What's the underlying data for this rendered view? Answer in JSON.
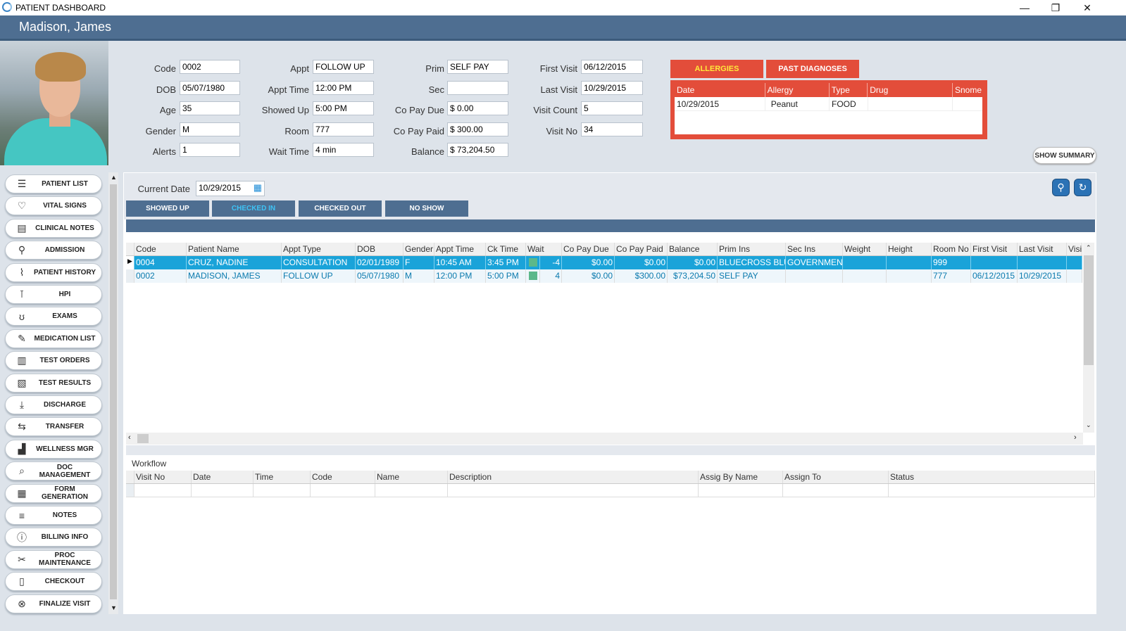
{
  "window": {
    "title": "PATIENT DASHBOARD"
  },
  "header": {
    "patient_name": "Madison, James"
  },
  "info": {
    "col1": [
      {
        "label": "Code",
        "value": "0002"
      },
      {
        "label": "DOB",
        "value": "05/07/1980"
      },
      {
        "label": "Age",
        "value": "35"
      },
      {
        "label": "Gender",
        "value": "M"
      },
      {
        "label": "Alerts",
        "value": "1"
      }
    ],
    "col2": [
      {
        "label": "Appt",
        "value": "FOLLOW UP"
      },
      {
        "label": "Appt Time",
        "value": "12:00 PM"
      },
      {
        "label": "Showed Up",
        "value": "5:00 PM"
      },
      {
        "label": "Room",
        "value": "777"
      },
      {
        "label": "Wait Time",
        "value": "4 min"
      }
    ],
    "col3": [
      {
        "label": "Prim",
        "value": "SELF PAY"
      },
      {
        "label": "Sec",
        "value": ""
      },
      {
        "label": "Co Pay Due",
        "value": "$ 0.00"
      },
      {
        "label": "Co Pay Paid",
        "value": "$ 300.00"
      },
      {
        "label": "Balance",
        "value": "$ 73,204.50"
      }
    ],
    "col4": [
      {
        "label": "First Visit",
        "value": "06/12/2015"
      },
      {
        "label": "Last Visit",
        "value": "10/29/2015"
      },
      {
        "label": "Visit Count",
        "value": "5"
      },
      {
        "label": "Visit No",
        "value": "34"
      }
    ]
  },
  "allergies": {
    "tab_allergies": "ALLERGIES",
    "tab_past": "PAST DIAGNOSES",
    "columns": [
      "Date",
      "Allergy",
      "Type",
      "Drug",
      "Snome"
    ],
    "rows": [
      [
        "10/29/2015",
        "Peanut",
        "FOOD",
        "",
        ""
      ]
    ]
  },
  "show_summary": "SHOW SUMMARY",
  "sidebar": {
    "items": [
      {
        "label": "PATIENT LIST",
        "icon": "id-card-icon",
        "glyph": "☰"
      },
      {
        "label": "VITAL SIGNS",
        "icon": "heartbeat-icon",
        "glyph": "♡"
      },
      {
        "label": "CLINICAL NOTES",
        "icon": "clinical-notes-icon",
        "glyph": "▤"
      },
      {
        "label": "ADMISSION",
        "icon": "admission-user-icon",
        "glyph": "⚲"
      },
      {
        "label": "PATIENT HISTORY",
        "icon": "chart-icon",
        "glyph": "⌇"
      },
      {
        "label": "HPI",
        "icon": "thermometer-icon",
        "glyph": "⊺"
      },
      {
        "label": "EXAMS",
        "icon": "stethoscope-icon",
        "glyph": "ʊ"
      },
      {
        "label": "MEDICATION LIST",
        "icon": "edit-list-icon",
        "glyph": "✎"
      },
      {
        "label": "TEST ORDERS",
        "icon": "clipboard-icon",
        "glyph": "▥"
      },
      {
        "label": "TEST RESULTS",
        "icon": "clipboard-check-icon",
        "glyph": "▧"
      },
      {
        "label": "DISCHARGE",
        "icon": "download-tray-icon",
        "glyph": "⤓"
      },
      {
        "label": "TRANSFER",
        "icon": "transfer-icon",
        "glyph": "⇆"
      },
      {
        "label": "WELLNESS MGR",
        "icon": "growth-chart-icon",
        "glyph": "▟"
      },
      {
        "label": "DOC MANAGEMENT",
        "icon": "document-search-icon",
        "glyph": "⌕"
      },
      {
        "label": "FORM GENERATION",
        "icon": "form-icon",
        "glyph": "▦"
      },
      {
        "label": "NOTES",
        "icon": "notes-icon",
        "glyph": "≡"
      },
      {
        "label": "BILLING INFO",
        "icon": "info-icon",
        "glyph": "ⓘ"
      },
      {
        "label": "PROC MAINTENANCE",
        "icon": "tools-icon",
        "glyph": "✂"
      },
      {
        "label": "CHECKOUT",
        "icon": "book-icon",
        "glyph": "▯"
      },
      {
        "label": "FINALIZE VISIT",
        "icon": "cancel-circle-icon",
        "glyph": "⊗"
      }
    ]
  },
  "main": {
    "current_date_label": "Current Date",
    "current_date_value": "10/29/2015",
    "tabs": [
      "SHOWED UP",
      "CHECKED IN",
      "CHECKED OUT",
      "NO SHOW"
    ],
    "active_tab": "CHECKED IN",
    "grid": {
      "columns": [
        "Code",
        "Patient Name",
        "Appt Type",
        "DOB",
        "Gender",
        "Appt Time",
        "Ck Time",
        "Wait",
        "Co Pay Due",
        "Co Pay Paid",
        "Balance",
        "Prim Ins",
        "Sec Ins",
        "Weight",
        "Height",
        "Room No",
        "First Visit",
        "Last Visit",
        "Visi"
      ],
      "rows": [
        [
          "0004",
          "CRUZ, NADINE",
          "CONSULTATION",
          "02/01/1989",
          "F",
          "10:45 AM",
          "3:45 PM",
          "-4",
          "$0.00",
          "$0.00",
          "$0.00",
          "BLUECROSS BLU",
          "GOVERNMENT",
          "",
          "",
          "999",
          "",
          "",
          ""
        ],
        [
          "0002",
          "MADISON, JAMES",
          "FOLLOW UP",
          "05/07/1980",
          "M",
          "12:00 PM",
          "5:00 PM",
          "4",
          "$0.00",
          "$300.00",
          "$73,204.50",
          "SELF PAY",
          "",
          "",
          "",
          "777",
          "06/12/2015",
          "10/29/2015",
          ""
        ]
      ]
    },
    "workflow": {
      "title": "Workflow",
      "columns": [
        "Visit No",
        "Date",
        "Time",
        "Code",
        "Name",
        "Description",
        "Assig By Name",
        "Assign To",
        "Status"
      ]
    }
  },
  "colors": {
    "header": "#4e6e91",
    "allergy_red": "#e34d3a",
    "selected_row": "#1aa3d9",
    "wait_indicator": "#5cb88a"
  }
}
